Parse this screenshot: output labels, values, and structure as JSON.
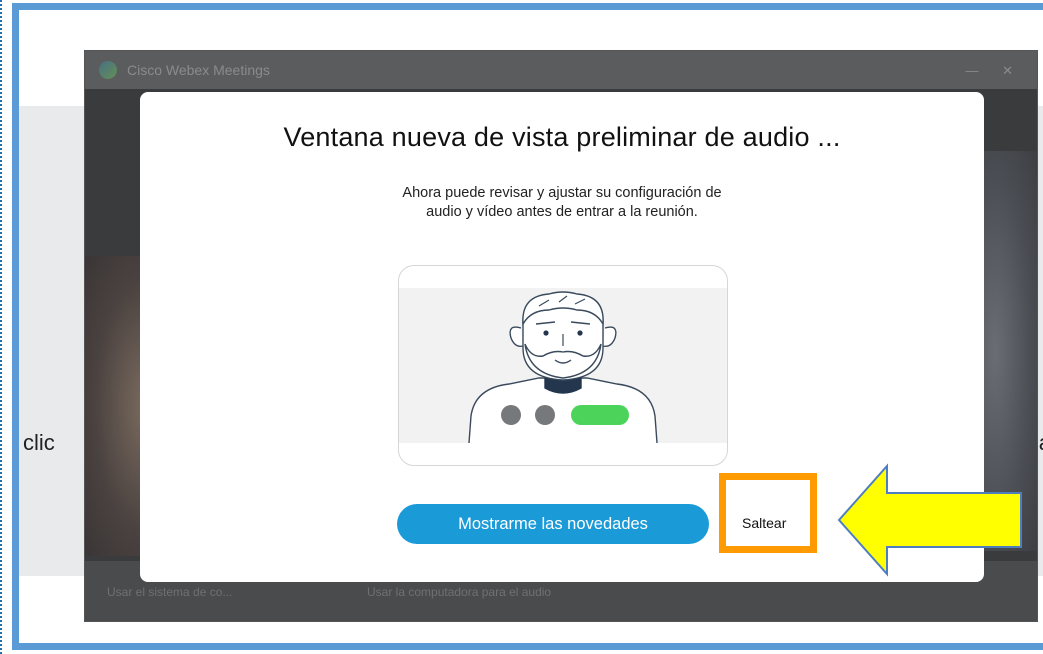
{
  "background": {
    "left_partial_text": "clic",
    "right_partial_text": "a"
  },
  "webex_window": {
    "title": "Cisco Webex Meetings",
    "controls": "— ✕",
    "bottom_left": "Usar el sistema de co...",
    "bottom_right": "Usar la computadora para el audio"
  },
  "dialog": {
    "title": "Ventana nueva de vista preliminar de audio ...",
    "description": "Ahora puede revisar y ajustar su configuración de audio y vídeo antes de entrar a la reunión.",
    "primary_button": "Mostrarme las novedades",
    "skip_button": "Saltear"
  },
  "colors": {
    "frame": "#5b9bd5",
    "primary": "#1b9ad8",
    "highlight": "#ff9a00",
    "arrow": "#ffff00",
    "toggle_on": "#4cd35a",
    "toggle_off": "#76787b"
  },
  "icons": [
    "webex-logo-icon",
    "person-illustration-icon",
    "left-pointing-arrow"
  ]
}
